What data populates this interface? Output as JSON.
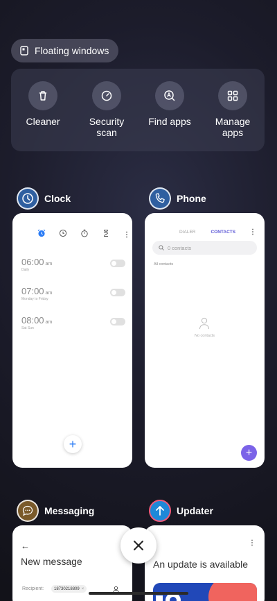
{
  "floating_windows": {
    "label": "Floating windows"
  },
  "tools": [
    {
      "label": "Cleaner",
      "icon": "trash-icon"
    },
    {
      "label": "Security scan",
      "icon": "security-gauge-icon"
    },
    {
      "label": "Find apps",
      "icon": "find-apps-icon"
    },
    {
      "label": "Manage apps",
      "icon": "grid-icon"
    }
  ],
  "apps": {
    "clock": {
      "name": "Clock",
      "alarms": [
        {
          "time": "06:00",
          "ampm": "am",
          "sub": "Daily"
        },
        {
          "time": "07:00",
          "ampm": "am",
          "sub": "Monday to Friday"
        },
        {
          "time": "08:00",
          "ampm": "am",
          "sub": "Sat Sun"
        }
      ]
    },
    "phone": {
      "name": "Phone",
      "tab_dialer": "DIALER",
      "tab_contacts": "CONTACTS",
      "search_placeholder": "0 contacts",
      "section": "All contacts",
      "empty": "No contacts"
    },
    "messaging": {
      "name": "Messaging",
      "title": "New message",
      "recipient_label": "Recipient:",
      "recipient_value": "18730218809",
      "chip_close": "×"
    },
    "updater": {
      "name": "Updater",
      "title": "An update is available"
    }
  },
  "colors": {
    "accent_blue": "#2b7cf5",
    "contacts_tab": "#5b57d6",
    "fab_purple": "#7b63e8"
  }
}
